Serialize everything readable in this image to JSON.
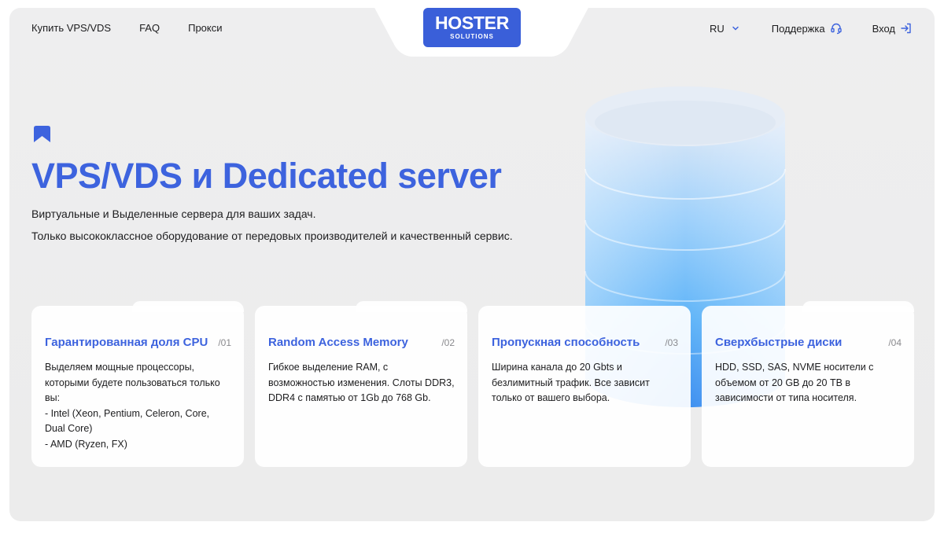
{
  "header": {
    "nav_left": [
      "Купить VPS/VDS",
      "FAQ",
      "Прокси"
    ],
    "logo": {
      "main": "HOSTER",
      "sub": "SOLUTIONS"
    },
    "language": "RU",
    "support_label": "Поддержка",
    "login_label": "Вход"
  },
  "hero": {
    "title": "VPS/VDS и Dedicated server",
    "subtitle_1": "Виртуальные и Выделенные сервера для ваших задач.",
    "subtitle_2": "Только высококлассное оборудование от передовых производителей и качественный сервис."
  },
  "cards": [
    {
      "title": "Гарантированная доля CPU",
      "num": "/01",
      "lines": [
        "Выделяем мощные процессоры, которыми будете пользоваться только вы:",
        "- Intel (Xeon, Pentium, Celeron, Core, Dual Core)",
        "- AMD (Ryzen, FX)"
      ]
    },
    {
      "title": "Random Access Memory",
      "num": "/02",
      "lines": [
        "Гибкое выделение RAM, с возможностью изменения. Слоты DDR3, DDR4 с памятью от 1Gb до 768 Gb."
      ]
    },
    {
      "title": "Пропускная способность",
      "num": "/03",
      "lines": [
        "Ширина канала до 20 Gbts и безлимитный трафик. Все зависит только от вашего выбора."
      ]
    },
    {
      "title": "Сверхбыстрые диски",
      "num": "/04",
      "lines": [
        "HDD, SSD, SAS, NVME носители с объемом от 20 GB до 20 TB в зависимости от типа носителя."
      ]
    }
  ],
  "colors": {
    "accent": "#3d63de",
    "logo_bg": "#3a5fd9",
    "background": "#ececec"
  },
  "icons": [
    "chevron-down-icon",
    "headset-icon",
    "login-icon",
    "bookmark-icon",
    "database-icon"
  ]
}
